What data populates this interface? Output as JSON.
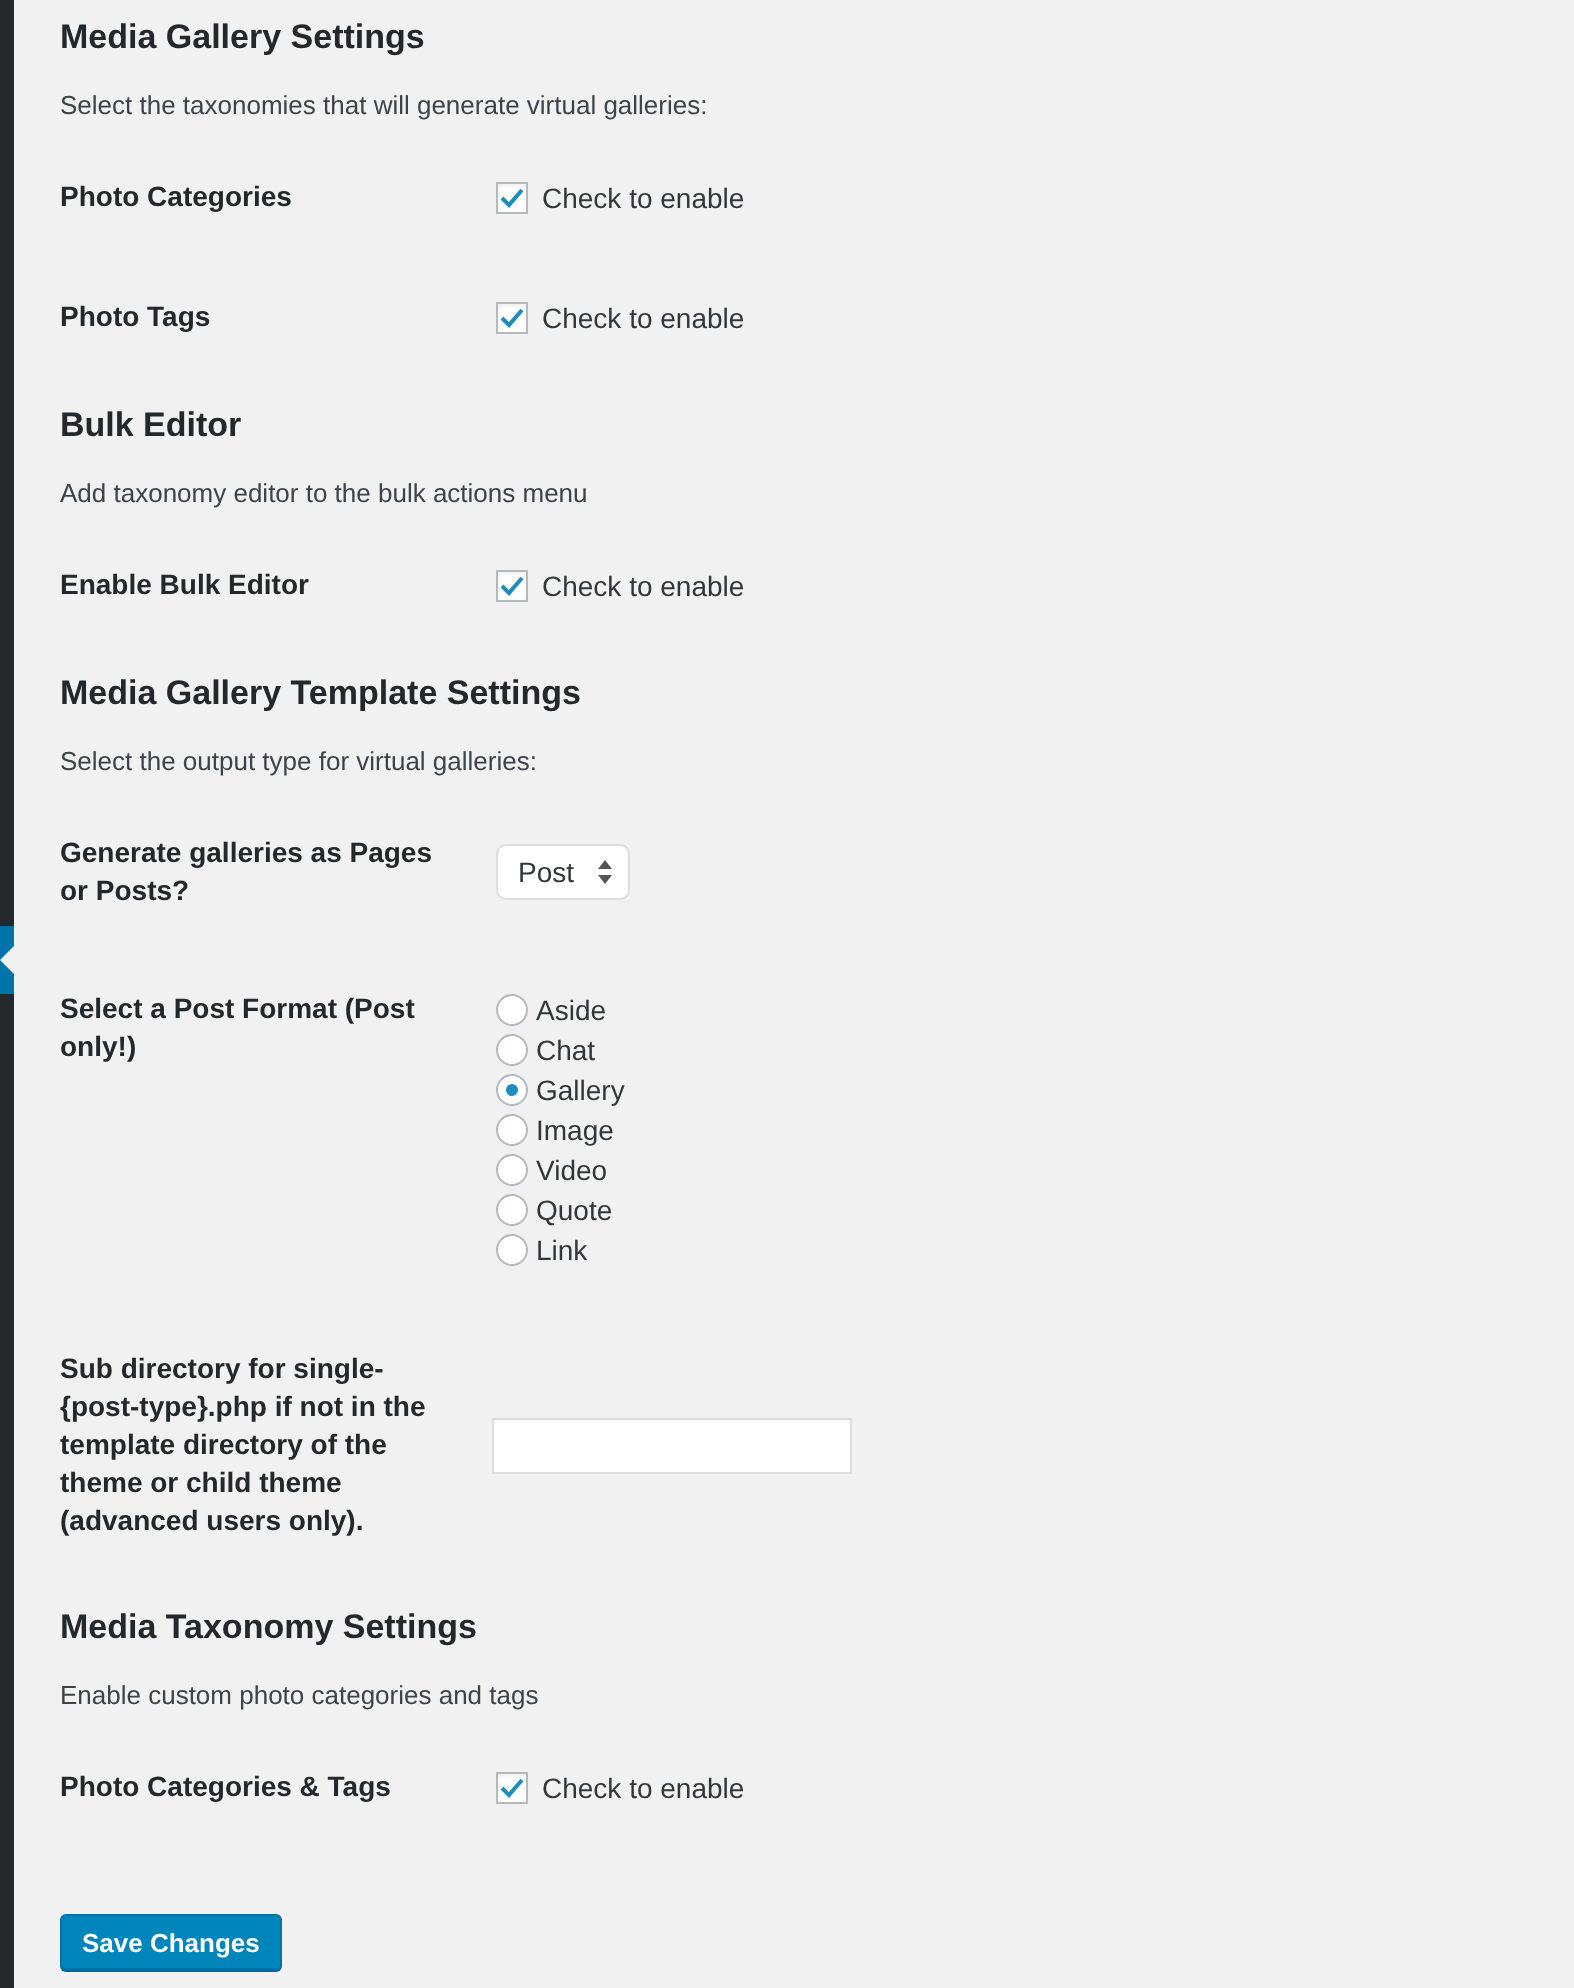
{
  "sections": [
    {
      "heading": "Media Gallery Settings",
      "description": "Select the taxonomies that will generate virtual galleries:",
      "fields": [
        {
          "kind": "checkbox",
          "label": "Photo Categories",
          "checked": true,
          "text": "Check to enable"
        },
        {
          "kind": "checkbox",
          "label": "Photo Tags",
          "checked": true,
          "text": "Check to enable"
        }
      ]
    },
    {
      "heading": "Bulk Editor",
      "description": "Add taxonomy editor to the bulk actions menu",
      "fields": [
        {
          "kind": "checkbox",
          "label": "Enable Bulk Editor",
          "checked": true,
          "text": "Check to enable"
        }
      ]
    },
    {
      "heading": "Media Gallery Template Settings",
      "description": "Select the output type for virtual galleries:",
      "fields": [
        {
          "kind": "select",
          "label": "Generate galleries as Pages or Posts?",
          "value": "Post"
        },
        {
          "kind": "radio",
          "label": "Select a Post Format (Post only!)",
          "options": [
            {
              "label": "Aside",
              "selected": false
            },
            {
              "label": "Chat",
              "selected": false
            },
            {
              "label": "Gallery",
              "selected": true
            },
            {
              "label": "Image",
              "selected": false
            },
            {
              "label": "Video",
              "selected": false
            },
            {
              "label": "Quote",
              "selected": false
            },
            {
              "label": "Link",
              "selected": false
            }
          ]
        },
        {
          "kind": "text",
          "label": "Sub directory for single-{post-type}.php if not in the template directory of the theme or child theme (advanced users only)."
        }
      ]
    },
    {
      "heading": "Media Taxonomy Settings",
      "description": "Enable custom photo categories and tags",
      "fields": [
        {
          "kind": "checkbox",
          "label": "Photo Categories & Tags",
          "checked": true,
          "text": "Check to enable"
        }
      ]
    }
  ],
  "save_button": "Save Changes"
}
